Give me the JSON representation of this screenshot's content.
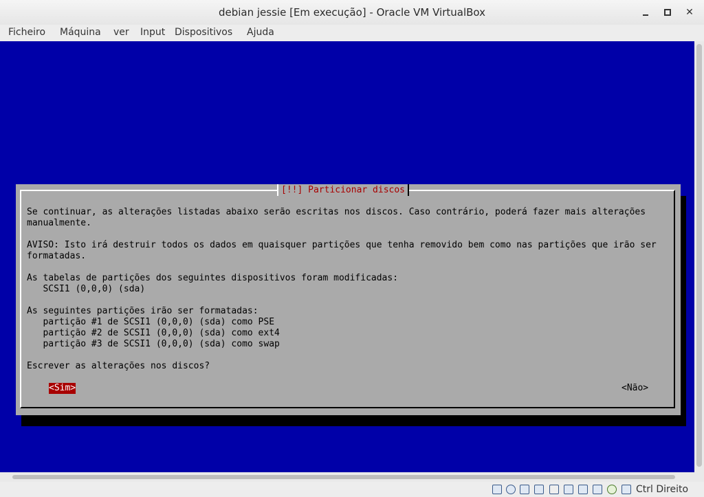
{
  "window": {
    "title": "debian jessie [Em execução] - Oracle VM VirtualBox",
    "buttons": {
      "minimize": "minimize",
      "maximize": "maximize",
      "close": "close"
    }
  },
  "menu": [
    "Ficheiro",
    "Máquina",
    "ver",
    "Input",
    "Dispositivos",
    "Ajuda"
  ],
  "dialog": {
    "title": "[!!] Particionar discos",
    "lines": [
      "Se continuar, as alterações listadas abaixo serão escritas nos discos. Caso contrário, poderá fazer mais alterações",
      "manualmente.",
      "",
      "AVISO: Isto irá destruir todos os dados em quaisquer partições que tenha removido bem como nas partições que irão ser",
      "formatadas.",
      "",
      "As tabelas de partições dos seguintes dispositivos foram modificadas:",
      "   SCSI1 (0,0,0) (sda)",
      "",
      "As seguintes partições irão ser formatadas:",
      "   partição #1 de SCSI1 (0,0,0) (sda) como PSE",
      "   partição #2 de SCSI1 (0,0,0) (sda) como ext4",
      "   partição #3 de SCSI1 (0,0,0) (sda) como swap",
      "",
      "Escrever as alterações nos discos?"
    ],
    "yes_button": "<Sim>",
    "no_button": "<Não>"
  },
  "statusbar": {
    "icons": [
      "hard-disk-icon",
      "optical-drive-icon",
      "audio-icon",
      "network-icon",
      "usb-icon",
      "shared-folders-icon",
      "display-icon",
      "video-capture-icon",
      "cpu-icon",
      "mouse-integration-icon",
      "capture-icon"
    ],
    "host_key": "Ctrl Direito"
  },
  "colors": {
    "screen_bg": "#0000a8",
    "dialog_bg": "#aaaaaa",
    "dialog_title": "#a80000",
    "selected_button_bg": "#a80000"
  }
}
